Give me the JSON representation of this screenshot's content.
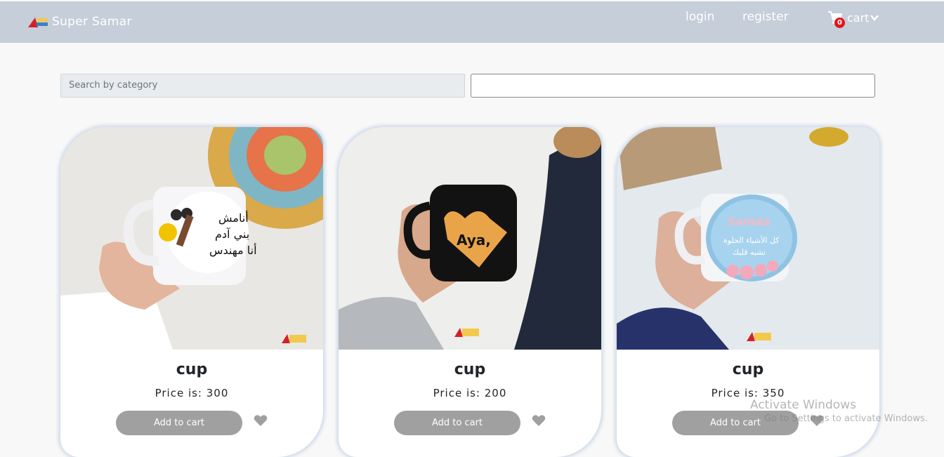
{
  "navbar": {
    "brand": "Super Samar",
    "login": "login",
    "register": "register",
    "cart_label": "cart",
    "cart_count": "0"
  },
  "search": {
    "category_placeholder": "Search by category",
    "text_value": ""
  },
  "products": [
    {
      "name": "cup",
      "price": "Price is: 300",
      "button": "Add to cart"
    },
    {
      "name": "cup",
      "price": "Price is: 200",
      "button": "Add to cart"
    },
    {
      "name": "cup",
      "price": "Price is: 350",
      "button": "Add to cart"
    }
  ],
  "watermark": {
    "title": "Activate Windows",
    "subtitle": "Go to Settings to activate Windows."
  },
  "colors": {
    "navbar": "#c5ced9",
    "button": "#a0a0a0",
    "badge": "#e0161b"
  }
}
